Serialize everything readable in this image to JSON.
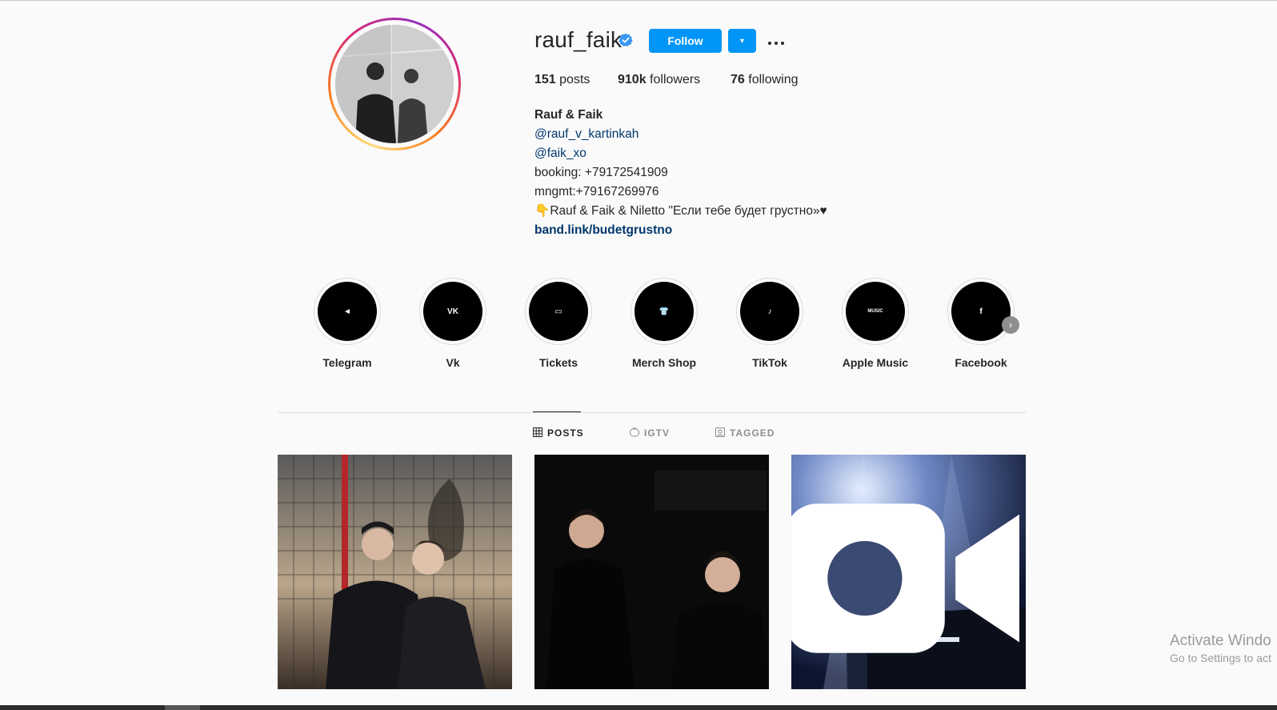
{
  "profile": {
    "username": "rauf_faik",
    "follow_label": "Follow",
    "dropdown_glyph": "▾",
    "verified_icon": "verified-badge-icon"
  },
  "stats": {
    "posts_count": "151",
    "posts_label": "posts",
    "followers_count": "910k",
    "followers_label": "followers",
    "following_count": "76",
    "following_label": "following"
  },
  "bio": {
    "name": "Rauf & Faik",
    "mention1": "@rauf_v_kartinkah",
    "mention2": "@faik_xo",
    "booking": "booking: +79172541909",
    "mngmt": "mngmt:+79167269976",
    "release_emoji": "👇",
    "release": "Rauf & Faik & Niletto \"Если тебе будет грустно»♥",
    "link": "band.link/budetgrustno"
  },
  "highlights": [
    {
      "label": "Telegram",
      "glyph": "◄",
      "icon": "telegram-icon"
    },
    {
      "label": "Vk",
      "glyph": "VK",
      "icon": "vk-icon"
    },
    {
      "label": "Tickets",
      "glyph": "▭",
      "icon": "ticket-icon"
    },
    {
      "label": "Merch Shop",
      "glyph": "👕",
      "icon": "tshirt-icon"
    },
    {
      "label": "TikTok",
      "glyph": "♪",
      "icon": "tiktok-icon"
    },
    {
      "label": "Apple Music",
      "glyph": "MUSIC",
      "icon": "apple-music-icon"
    },
    {
      "label": "Facebook",
      "glyph": "f",
      "icon": "facebook-icon"
    }
  ],
  "tabs": [
    {
      "label": "POSTS",
      "active": true
    },
    {
      "label": "IGTV",
      "active": false
    },
    {
      "label": "TAGGED",
      "active": false
    }
  ],
  "watermark": {
    "line1": "Activate Windo",
    "line2": "Go to Settings to act"
  },
  "colors": {
    "accent": "#0095f6",
    "link": "#00376b",
    "text": "#262626",
    "muted": "#8e8e8e",
    "background": "#fafafa"
  }
}
